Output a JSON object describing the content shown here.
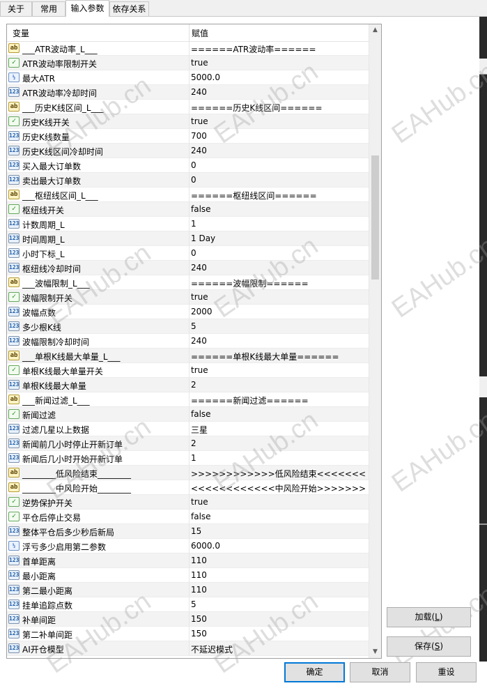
{
  "tabs": [
    {
      "label": "关于"
    },
    {
      "label": "常用"
    },
    {
      "label": "输入参数",
      "active": true
    },
    {
      "label": "依存关系"
    }
  ],
  "grid": {
    "col_variable": "变量",
    "col_value": "赋值",
    "rows": [
      {
        "icon": "ab",
        "name": "___ATR波动率_L___",
        "value": "======ATR波动率======"
      },
      {
        "icon": "bool",
        "name": "ATR波动率限制开关",
        "value": "true"
      },
      {
        "icon": "double",
        "name": "最大ATR",
        "value": "5000.0"
      },
      {
        "icon": "int",
        "name": "ATR波动率冷却时间",
        "value": "240"
      },
      {
        "icon": "ab",
        "name": "___历史K线区间_L___",
        "value": "======历史K线区间======"
      },
      {
        "icon": "bool",
        "name": "历史K线开关",
        "value": "true"
      },
      {
        "icon": "int",
        "name": "历史K线数量",
        "value": "700"
      },
      {
        "icon": "int",
        "name": "历史K线区间冷却时间",
        "value": "240"
      },
      {
        "icon": "int",
        "name": "买入最大订单数",
        "value": "0"
      },
      {
        "icon": "int",
        "name": "卖出最大订单数",
        "value": "0"
      },
      {
        "icon": "ab",
        "name": "___枢纽线区间_L___",
        "value": "======枢纽线区间======"
      },
      {
        "icon": "bool",
        "name": "枢纽线开关",
        "value": "false"
      },
      {
        "icon": "int",
        "name": "计数周期_L",
        "value": "1"
      },
      {
        "icon": "int",
        "name": "时间周期_L",
        "value": "1 Day"
      },
      {
        "icon": "int",
        "name": "小时下标_L",
        "value": "0"
      },
      {
        "icon": "int",
        "name": "枢纽线冷却时间",
        "value": "240"
      },
      {
        "icon": "ab",
        "name": "___波幅限制_L___",
        "value": "======波幅限制======"
      },
      {
        "icon": "bool",
        "name": "波幅限制开关",
        "value": "true"
      },
      {
        "icon": "int",
        "name": "波幅点数",
        "value": "2000"
      },
      {
        "icon": "int",
        "name": "多少根K线",
        "value": "5"
      },
      {
        "icon": "int",
        "name": "波幅限制冷却时间",
        "value": "240"
      },
      {
        "icon": "ab",
        "name": "___单根K线最大单量_L___",
        "value": "======单根K线最大单量======"
      },
      {
        "icon": "bool",
        "name": "单根K线最大单量开关",
        "value": "true"
      },
      {
        "icon": "int",
        "name": "单根K线最大单量",
        "value": "2"
      },
      {
        "icon": "ab",
        "name": "___新闻过滤_L___",
        "value": "======新闻过滤======"
      },
      {
        "icon": "bool",
        "name": "新闻过滤",
        "value": "false"
      },
      {
        "icon": "int",
        "name": "过滤几星以上数据",
        "value": "三星"
      },
      {
        "icon": "int",
        "name": "新闻前几小时停止开新订单",
        "value": "2"
      },
      {
        "icon": "int",
        "name": "新闻后几小时开始开新订单",
        "value": "1"
      },
      {
        "icon": "ab",
        "name": "________低风险结束________",
        "value": ">>>>>>>>>>>>低风险结束<<<<<<<<<<<<"
      },
      {
        "icon": "ab",
        "name": "________中风险开始________",
        "value": "<<<<<<<<<<<<中风险开始>>>>>>>>>>>>"
      },
      {
        "icon": "bool",
        "name": "逆势保护开关",
        "value": "true"
      },
      {
        "icon": "bool",
        "name": "平仓后停止交易",
        "value": "false"
      },
      {
        "icon": "int",
        "name": "整体平仓后多少秒后新局",
        "value": "15"
      },
      {
        "icon": "double",
        "name": "浮亏多少启用第二参数",
        "value": "6000.0"
      },
      {
        "icon": "int",
        "name": "首单距离",
        "value": "110"
      },
      {
        "icon": "int",
        "name": "最小距离",
        "value": "110"
      },
      {
        "icon": "int",
        "name": "第二最小距离",
        "value": "110"
      },
      {
        "icon": "int",
        "name": "挂单追踪点数",
        "value": "5"
      },
      {
        "icon": "int",
        "name": "补单间距",
        "value": "150"
      },
      {
        "icon": "int",
        "name": "第二补单间距",
        "value": "150"
      },
      {
        "icon": "int",
        "name": "AI开仓模型",
        "value": "不延迟模式"
      }
    ]
  },
  "icon_glyphs": {
    "ab": "ab",
    "bool": "✓",
    "double": "½",
    "int": "123"
  },
  "buttons": {
    "load": {
      "label": "加载",
      "accel": "L"
    },
    "save": {
      "label": "保存",
      "accel": "S"
    },
    "ok": "确定",
    "cancel": "取消",
    "reset": "重设"
  },
  "watermark": "EAHub.cn"
}
